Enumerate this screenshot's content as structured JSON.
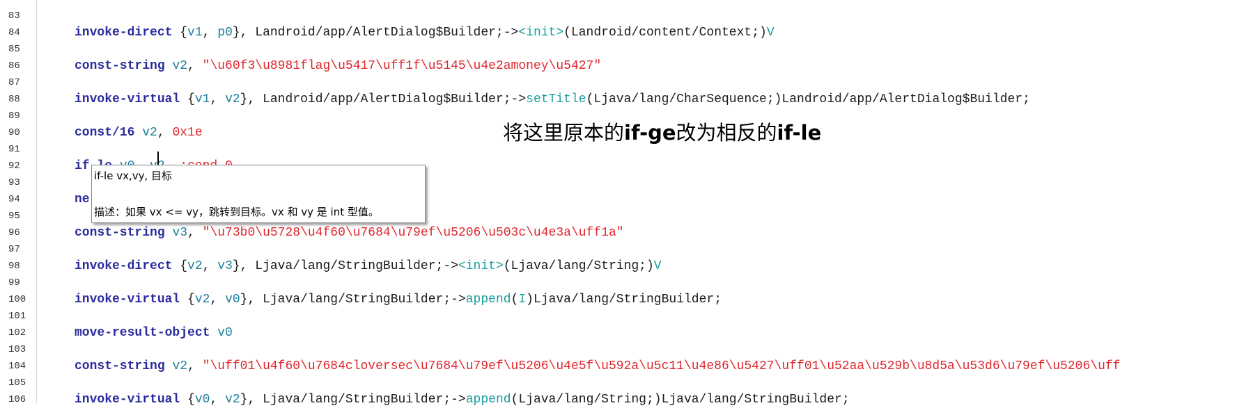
{
  "editor": {
    "lines": [
      {
        "num": "83",
        "tokens": []
      },
      {
        "num": "84",
        "tokens": [
          {
            "t": "invoke-direct",
            "c": "kw"
          },
          {
            "t": " {",
            "c": "plain"
          },
          {
            "t": "v1",
            "c": "reg"
          },
          {
            "t": ", ",
            "c": "plain"
          },
          {
            "t": "p0",
            "c": "reg"
          },
          {
            "t": "}, Landroid/app/AlertDialog$Builder;->",
            "c": "plain"
          },
          {
            "t": "<init>",
            "c": "mth"
          },
          {
            "t": "(Landroid/content/Context;)",
            "c": "plain"
          },
          {
            "t": "V",
            "c": "mth"
          }
        ]
      },
      {
        "num": "85",
        "tokens": []
      },
      {
        "num": "86",
        "tokens": [
          {
            "t": "const-string",
            "c": "kw"
          },
          {
            "t": " ",
            "c": "plain"
          },
          {
            "t": "v2",
            "c": "reg"
          },
          {
            "t": ", ",
            "c": "plain"
          },
          {
            "t": "\"\\u60f3\\u8981flag\\u5417\\uff1f\\u5145\\u4e2amoney\\u5427\"",
            "c": "str"
          }
        ]
      },
      {
        "num": "87",
        "tokens": []
      },
      {
        "num": "88",
        "tokens": [
          {
            "t": "invoke-virtual",
            "c": "kw"
          },
          {
            "t": " {",
            "c": "plain"
          },
          {
            "t": "v1",
            "c": "reg"
          },
          {
            "t": ", ",
            "c": "plain"
          },
          {
            "t": "v2",
            "c": "reg"
          },
          {
            "t": "}, Landroid/app/AlertDialog$Builder;->",
            "c": "plain"
          },
          {
            "t": "setTitle",
            "c": "mth"
          },
          {
            "t": "(Ljava/lang/CharSequence;)Landroid/app/AlertDialog$Builder;",
            "c": "plain"
          }
        ]
      },
      {
        "num": "89",
        "tokens": []
      },
      {
        "num": "90",
        "tokens": [
          {
            "t": "const/16",
            "c": "kw"
          },
          {
            "t": " ",
            "c": "plain"
          },
          {
            "t": "v2",
            "c": "reg"
          },
          {
            "t": ", ",
            "c": "plain"
          },
          {
            "t": "0x1e",
            "c": "str"
          }
        ]
      },
      {
        "num": "91",
        "tokens": []
      },
      {
        "num": "92",
        "tokens": [
          {
            "t": "if-le",
            "c": "kw"
          },
          {
            "t": " ",
            "c": "plain"
          },
          {
            "t": "v0",
            "c": "reg"
          },
          {
            "t": ", ",
            "c": "plain"
          },
          {
            "t": "v2",
            "c": "reg"
          },
          {
            "t": ", ",
            "c": "plain"
          },
          {
            "t": ":cond_0",
            "c": "str"
          }
        ]
      },
      {
        "num": "93",
        "tokens": []
      },
      {
        "num": "94",
        "tokens": [
          {
            "t": "ne",
            "c": "kw"
          }
        ]
      },
      {
        "num": "95",
        "tokens": []
      },
      {
        "num": "96",
        "tokens": [
          {
            "t": "const-string",
            "c": "kw"
          },
          {
            "t": " ",
            "c": "plain"
          },
          {
            "t": "v3",
            "c": "reg"
          },
          {
            "t": ", ",
            "c": "plain"
          },
          {
            "t": "\"\\u73b0\\u5728\\u4f60\\u7684\\u79ef\\u5206\\u503c\\u4e3a\\uff1a\"",
            "c": "str"
          }
        ]
      },
      {
        "num": "97",
        "tokens": []
      },
      {
        "num": "98",
        "tokens": [
          {
            "t": "invoke-direct",
            "c": "kw"
          },
          {
            "t": " {",
            "c": "plain"
          },
          {
            "t": "v2",
            "c": "reg"
          },
          {
            "t": ", ",
            "c": "plain"
          },
          {
            "t": "v3",
            "c": "reg"
          },
          {
            "t": "}, Ljava/lang/StringBuilder;->",
            "c": "plain"
          },
          {
            "t": "<init>",
            "c": "mth"
          },
          {
            "t": "(Ljava/lang/String;)",
            "c": "plain"
          },
          {
            "t": "V",
            "c": "mth"
          }
        ]
      },
      {
        "num": "99",
        "tokens": []
      },
      {
        "num": "100",
        "tokens": [
          {
            "t": "invoke-virtual",
            "c": "kw"
          },
          {
            "t": " {",
            "c": "plain"
          },
          {
            "t": "v2",
            "c": "reg"
          },
          {
            "t": ", ",
            "c": "plain"
          },
          {
            "t": "v0",
            "c": "reg"
          },
          {
            "t": "}, Ljava/lang/StringBuilder;->",
            "c": "plain"
          },
          {
            "t": "append",
            "c": "mth"
          },
          {
            "t": "(",
            "c": "plain"
          },
          {
            "t": "I",
            "c": "mth"
          },
          {
            "t": ")Ljava/lang/StringBuilder;",
            "c": "plain"
          }
        ]
      },
      {
        "num": "101",
        "tokens": []
      },
      {
        "num": "102",
        "tokens": [
          {
            "t": "move-result-object",
            "c": "kw"
          },
          {
            "t": " ",
            "c": "plain"
          },
          {
            "t": "v0",
            "c": "reg"
          }
        ]
      },
      {
        "num": "103",
        "tokens": []
      },
      {
        "num": "104",
        "tokens": [
          {
            "t": "const-string",
            "c": "kw"
          },
          {
            "t": " ",
            "c": "plain"
          },
          {
            "t": "v2",
            "c": "reg"
          },
          {
            "t": ", ",
            "c": "plain"
          },
          {
            "t": "\"\\uff01\\u4f60\\u7684cloversec\\u7684\\u79ef\\u5206\\u4e5f\\u592a\\u5c11\\u4e86\\u5427\\uff01\\u52aa\\u529b\\u8d5a\\u53d6\\u79ef\\u5206\\uff",
            "c": "str"
          }
        ]
      },
      {
        "num": "105",
        "tokens": []
      },
      {
        "num": "106",
        "tokens": [
          {
            "t": "invoke-virtual",
            "c": "kw"
          },
          {
            "t": " {",
            "c": "plain"
          },
          {
            "t": "v0",
            "c": "reg"
          },
          {
            "t": ", ",
            "c": "plain"
          },
          {
            "t": "v2",
            "c": "reg"
          },
          {
            "t": "}, Ljava/lang/StringBuilder;->",
            "c": "plain"
          },
          {
            "t": "append",
            "c": "mth"
          },
          {
            "t": "(Ljava/lang/String;)Ljava/lang/StringBuilder;",
            "c": "plain"
          }
        ]
      }
    ]
  },
  "tooltip": {
    "title": "if-le vx,vy, 目标",
    "description": "描述：如果 vx <= vy，跳转到目标。vx 和 vy 是 int 型值。"
  },
  "annotation": {
    "part1": "将这里原本的",
    "kw1": "if-ge",
    "part2": "改为相反的",
    "kw2": "if-le"
  },
  "colors": {
    "keyword": "#2b2b9e",
    "register": "#1f7f9c",
    "string": "#e0262d",
    "method": "#1a9c9c"
  }
}
